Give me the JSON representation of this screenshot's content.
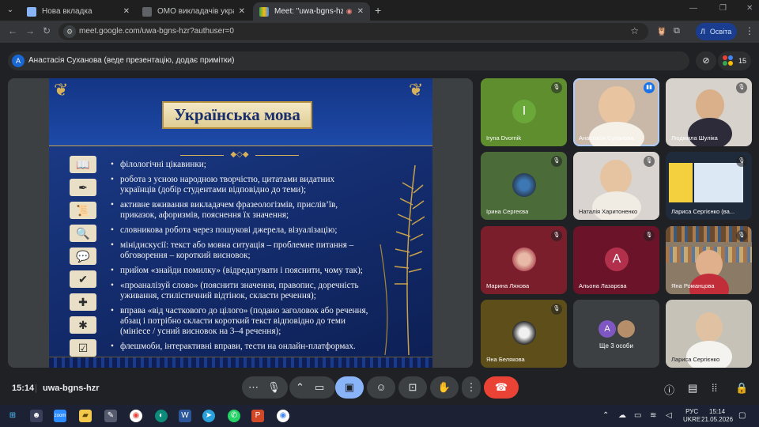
{
  "browser": {
    "tabs": [
      {
        "title": "Нова вкладка",
        "favicon_color": "#8ab4f8",
        "active": false
      },
      {
        "title": "ОМО викладачів української м",
        "favicon_color": "#5f6368",
        "active": false
      },
      {
        "title": "Meet: \"uwa-bgns-hzr\"",
        "favicon_color": "#34a853",
        "active": true
      }
    ],
    "url": "meet.google.com/uwa-bgns-hzr?authuser=0",
    "profile_label": "Освіта",
    "profile_initial": "Л"
  },
  "meet": {
    "presenter_initial": "А",
    "presenter_text": "Анастасія Суханова (веде презентацію, додає примітки)",
    "participant_count": "15",
    "slide": {
      "title": "Українська мова",
      "bullets": [
        "філологічні цікавинки;",
        "робота з усною народною творчістю, цитатами видатних українців (добір студентами відповідно до теми);",
        "активне вживання викладачем фразеологізмів, прислів’їв, приказок, афоризмів, пояснення їх значення;",
        "словникова робота через пошукові джерела, візуалізацію;",
        "мінідискусії: текст або мовна ситуація – проблемне питання – обговорення – короткий висновок;",
        "прийом «знайди помилку» (відредагувати і пояснити, чому так);",
        "«проаналізуй слово» (пояснити значення, правопис, доречність уживання, стилістичний відтінок, скласти речення);",
        "вправа «від часткового до цілого» (подано заголовок або речення, абзац і потрібно скласти короткий текст відповідно до теми (мінiесе / усний висновок на 3–4 речення);",
        "флешмоби, інтерактивні вправи, тести на онлайн-платформах."
      ]
    },
    "participants": [
      {
        "name": "Iryna Dvornik",
        "initial": "I",
        "type": "avatar",
        "color": "#5e8e2e",
        "bg": "#5e8e2e"
      },
      {
        "name": "Анастасія Суханова",
        "type": "video",
        "bg": "#c9b8a8",
        "speaking": true
      },
      {
        "name": "Людмила Шуліка",
        "type": "video",
        "bg": "#d7d2cb"
      },
      {
        "name": "Ірина Сергеєва",
        "type": "thumb",
        "bg": "#4b6b38"
      },
      {
        "name": "Наталія Харитоненко",
        "type": "video",
        "bg": "#d9d4cf"
      },
      {
        "name": "Лариса Сергієнко (ва...",
        "type": "screen",
        "bg": "#1f2a3a"
      },
      {
        "name": "Марина Ляхова",
        "type": "thumb",
        "bg": "#7a1e2c"
      },
      {
        "name": "Альона Лазарєва",
        "initial": "A",
        "type": "avatar",
        "color": "#b3304c",
        "bg": "#6b1328"
      },
      {
        "name": "Яна Романцова",
        "type": "video",
        "bg": "#8a7a66"
      },
      {
        "name": "Яна Белякова",
        "type": "thumb",
        "bg": "#5e4f1a"
      },
      {
        "name": "Ще 3 особи",
        "type": "more",
        "bg": "#3c4043"
      },
      {
        "name": "Лариса Сергієнко",
        "type": "video",
        "bg": "#c7c2b8"
      }
    ],
    "more_initial": "A"
  },
  "controls": {
    "time": "15:14",
    "separator": "|",
    "meeting_code": "uwa-bgns-hzr"
  },
  "taskbar": {
    "lang_top": "РУС",
    "lang_bottom": "UKRE",
    "clock_time": "15:14",
    "clock_date": "21.05.2026"
  },
  "colors": {
    "end_call": "#ea4335",
    "present_active": "#8ab4f8",
    "accent": "#1a73e8"
  }
}
